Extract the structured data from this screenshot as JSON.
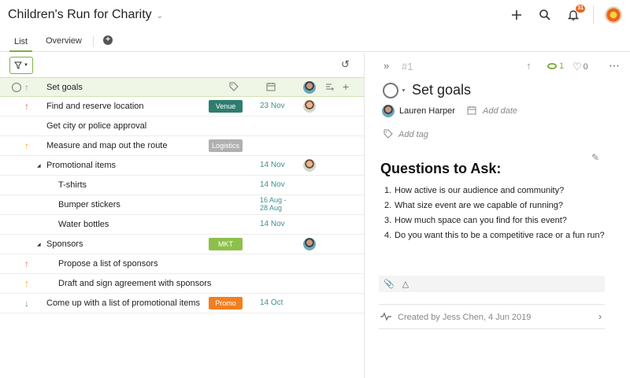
{
  "header": {
    "project_title": "Children's Run for Charity",
    "notifications_badge": "31",
    "icons": [
      "plus-icon",
      "search-icon",
      "bell-icon"
    ]
  },
  "tabs": [
    {
      "label": "List",
      "active": true
    },
    {
      "label": "Overview",
      "active": false
    }
  ],
  "list": {
    "rows": [
      {
        "name": "Set goals",
        "priority": "up",
        "tag": "",
        "date": "",
        "level": 0,
        "selected": true
      },
      {
        "name": "Find and reserve location",
        "priority": "up-red",
        "tag": "Venue",
        "tag_color": "#2e7d6e",
        "date": "23 Nov",
        "level": 0
      },
      {
        "name": "Get city or police approval",
        "priority": "",
        "tag": "",
        "date": "",
        "level": 0
      },
      {
        "name": "Measure and map out the route",
        "priority": "up-orange",
        "tag": "Logistics",
        "tag_color": "#b0b0b0",
        "date": "",
        "level": 0
      },
      {
        "name": "Promotional items",
        "priority": "",
        "tag": "",
        "date": "14 Nov",
        "level": 0,
        "expandable": true
      },
      {
        "name": "T-shirts",
        "priority": "",
        "tag": "",
        "date": "14 Nov",
        "level": 1
      },
      {
        "name": "Bumper stickers",
        "priority": "",
        "tag": "",
        "date_line1": "16 Aug -",
        "date_line2": "28 Aug",
        "level": 1
      },
      {
        "name": "Water bottles",
        "priority": "",
        "tag": "",
        "date": "14 Nov",
        "level": 1
      },
      {
        "name": "Sponsors",
        "priority": "",
        "tag": "MKT",
        "tag_color": "#8dc04a",
        "date": "",
        "level": 0,
        "expandable": true
      },
      {
        "name": "Propose a list of sponsors",
        "priority": "up-red",
        "tag": "",
        "date": "",
        "level": 1
      },
      {
        "name": "Draft and sign agreement with sponsors",
        "priority": "up-orange",
        "tag": "",
        "date": "",
        "level": 1
      },
      {
        "name": "Come up with a list of promotional items",
        "priority": "down",
        "tag": "Promo",
        "tag_color": "#f07f22",
        "date": "14 Oct",
        "level": 0
      }
    ]
  },
  "detail": {
    "task_number": "#1",
    "watchers": "1",
    "likes": "0",
    "title": "Set goals",
    "assignee": "Lauren Harper",
    "add_date": "Add date",
    "add_tag": "Add tag",
    "description_title": "Questions to Ask:",
    "questions": [
      "How active is our audience and community?",
      "What size event are we capable of running?",
      "How much space can you find for this event?",
      "Do you want this to be a competitive race or a fun run?"
    ],
    "created_by": "Created by Jess Chen, 4 Jun 2019"
  },
  "colors": {
    "accent": "#7bb141",
    "date": "#3f8f8f",
    "badge": "#e9661d"
  }
}
